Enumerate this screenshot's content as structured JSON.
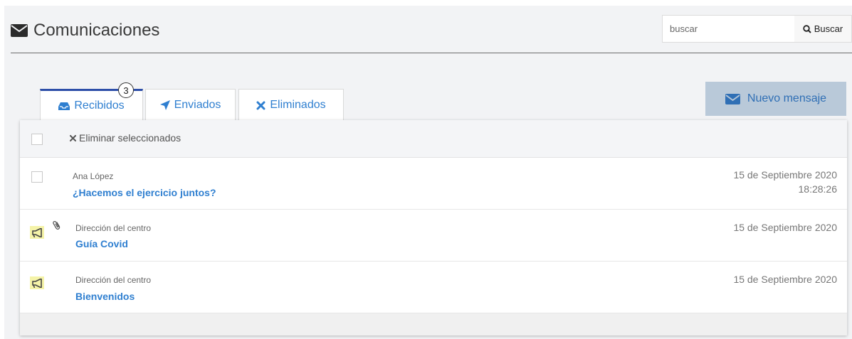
{
  "header": {
    "title": "Comunicaciones",
    "title_icon": "envelope-icon"
  },
  "search": {
    "placeholder": "buscar",
    "value": "",
    "button_label": "Buscar",
    "button_icon": "search-icon"
  },
  "tabs": [
    {
      "label": "Recibidos",
      "icon": "inbox-icon",
      "active": true,
      "badge": "3"
    },
    {
      "label": "Enviados",
      "icon": "paper-plane-icon",
      "active": false
    },
    {
      "label": "Eliminados",
      "icon": "times-icon",
      "active": false
    }
  ],
  "new_message": {
    "label": "Nuevo mensaje",
    "icon": "envelope-icon"
  },
  "toolbar": {
    "delete_selected_label": "Eliminar seleccionados",
    "delete_icon": "times-icon"
  },
  "messages": [
    {
      "sender": "Ana López",
      "subject": "¿Hacemos el ejercicio juntos?",
      "date": "15 de Septiembre 2020",
      "time": "18:28:26",
      "selectable": true,
      "announcement": false,
      "attachment": false
    },
    {
      "sender": "Dirección del centro",
      "subject": "Guía Covid",
      "date": "15 de Septiembre 2020",
      "time": "",
      "selectable": false,
      "announcement": true,
      "attachment": true
    },
    {
      "sender": "Dirección del centro",
      "subject": "Bienvenidos",
      "date": "15 de Septiembre 2020",
      "time": "",
      "selectable": false,
      "announcement": true,
      "attachment": false
    }
  ],
  "colors": {
    "accent": "#2f7fd0",
    "active_tab_border": "#2d4ea8",
    "new_message_bg": "#b9c9d9",
    "announcement_highlight": "#f5f3a8"
  }
}
